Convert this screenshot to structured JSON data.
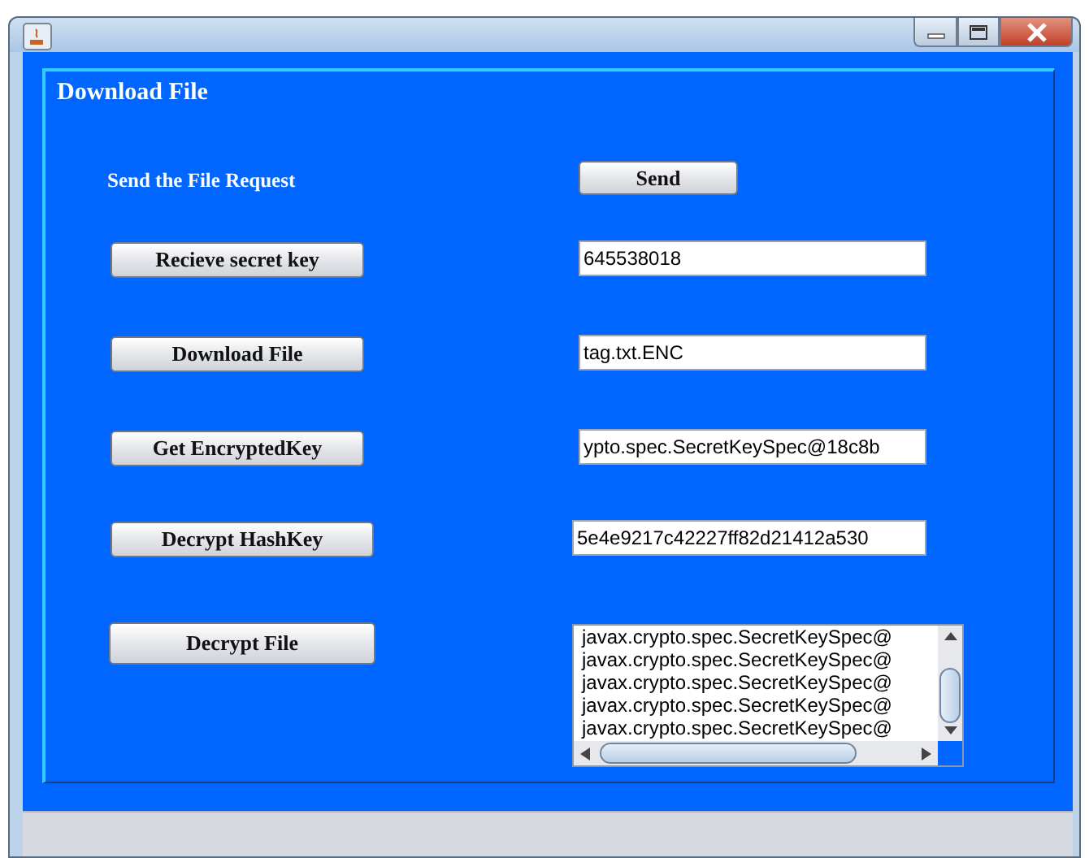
{
  "window": {
    "title_bar": {
      "buttons": [
        {
          "kind": "minimize"
        },
        {
          "kind": "maximize"
        },
        {
          "kind": "close"
        }
      ]
    }
  },
  "panel": {
    "title": "Download File",
    "rows": [
      {
        "left": {
          "kind": "label",
          "text": "Send the File Request"
        },
        "right": {
          "kind": "button",
          "text": "Send"
        }
      },
      {
        "left": {
          "kind": "button",
          "text": "Recieve secret key"
        },
        "right": {
          "kind": "field",
          "value": "645538018"
        }
      },
      {
        "left": {
          "kind": "button",
          "text": "Download File"
        },
        "right": {
          "kind": "field",
          "value": "tag.txt.ENC"
        }
      },
      {
        "left": {
          "kind": "button",
          "text": "Get EncryptedKey"
        },
        "right": {
          "kind": "field",
          "value": "ypto.spec.SecretKeySpec@18c8b"
        }
      },
      {
        "left": {
          "kind": "button",
          "text": "Decrypt HashKey"
        },
        "right": {
          "kind": "field",
          "value": "5e4e9217c42227ff82d21412a530"
        }
      },
      {
        "left": {
          "kind": "button",
          "text": "Decrypt File"
        },
        "right": {
          "kind": "textarea",
          "lines": [
            "javax.crypto.spec.SecretKeySpec@",
            "javax.crypto.spec.SecretKeySpec@",
            "javax.crypto.spec.SecretKeySpec@",
            "javax.crypto.spec.SecretKeySpec@",
            "javax.crypto.spec.SecretKeySpec@"
          ]
        }
      }
    ]
  }
}
